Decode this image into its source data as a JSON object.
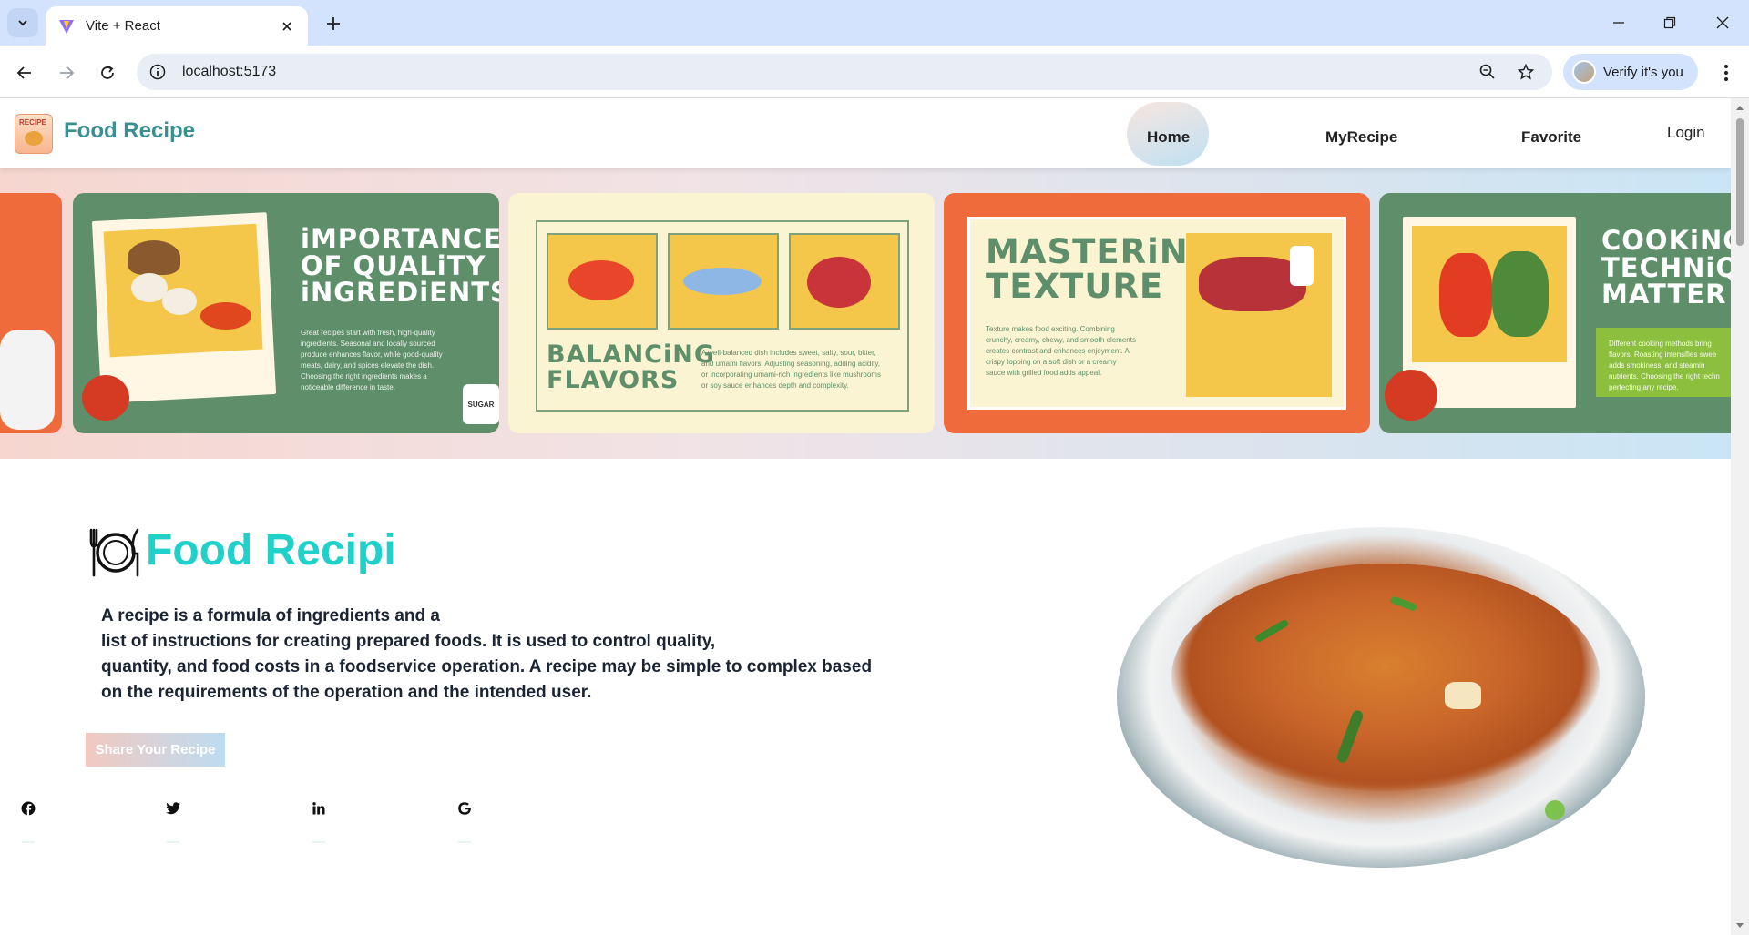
{
  "browser": {
    "tab_title": "Vite + React",
    "url": "localhost:5173",
    "profile_label": "Verify it's you"
  },
  "site": {
    "brand": "Food Recipe",
    "logo_text": "RECIPE",
    "nav": [
      "Home",
      "MyRecipe",
      "Favorite"
    ],
    "login": "Login"
  },
  "carousel": {
    "cards": [
      {
        "title": "iMPORTANCE\nOF QUALiTY\niNGREDiENTS",
        "text": "Great recipes start with fresh, high-quality\ningredients. Seasonal and locally sourced\nproduce enhances flavor, while good-quality\nmeats, dairy, and spices elevate the dish.\nChoosing the right ingredients makes a\nnoticeable difference in taste.",
        "sticker": "SUGAR"
      },
      {
        "title": "BALANCiNG\nFLAVORS",
        "text": "A well-balanced dish includes sweet, salty, sour, bitter,\nand umami flavors. Adjusting seasoning, adding acidity,\nor incorporating umami-rich ingredients like mushrooms\nor soy sauce enhances depth and complexity."
      },
      {
        "title": "MASTERiNG\nTEXTURE",
        "text": "Texture makes food exciting. Combining\ncrunchy, creamy, chewy, and smooth elements\ncreates contrast and enhances enjoyment. A\ncrispy topping on a soft dish or a creamy\nsauce with grilled food adds appeal."
      },
      {
        "title": "COOKiNG\nTECHNiQUE\nMATTER",
        "text": "Different cooking methods bring\nflavors. Roasting intensifies swee\nadds smokiness, and steamin\nnutrients. Choosing the right techn\nperfecting any recipe."
      }
    ]
  },
  "hero": {
    "title": "Food Recipi",
    "text": "A recipe is a formula of ingredients and a\nlist of instructions for creating prepared foods. It is used to control quality,\nquantity, and food costs in a foodservice operation. A recipe may be simple to complex based\non the requirements of the operation and the intended user.",
    "button": "Share Your Recipe"
  },
  "social": [
    "facebook-icon",
    "twitter-icon",
    "linkedin-icon",
    "google-icon"
  ],
  "colors": {
    "accent": "#1fd1c8",
    "brand": "#3a8f91",
    "card_green": "#5e8f6a",
    "card_orange": "#ef6b3b",
    "card_cream": "#fbf4d2"
  }
}
